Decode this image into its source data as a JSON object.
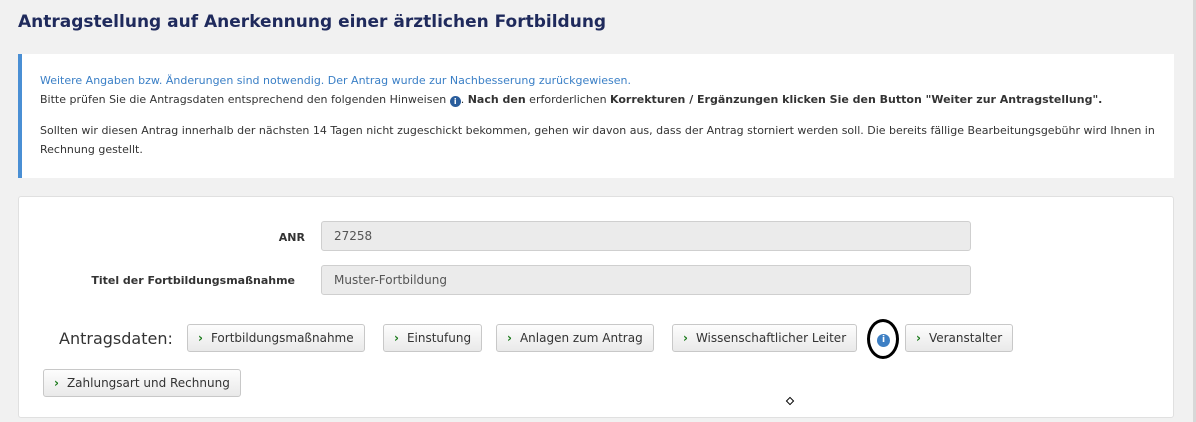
{
  "page": {
    "title": "Antragstellung auf Anerkennung einer ärztlichen Fortbildung"
  },
  "notice": {
    "line1": "Weitere Angaben bzw. Änderungen sind notwendig. Der Antrag wurde zur Nachbesserung zurückgewiesen.",
    "line2_pre": "Bitte prüfen Sie die Antragsdaten entsprechend den folgenden Hinweisen ",
    "line2_mid1": ". ",
    "line2_bold1": "Nach den",
    "line2_mid2": " erforderlichen ",
    "line2_bold2": "Korrekturen / Ergänzungen klicken Sie den Button \"Weiter zur Antragstellung\".",
    "para2": "Sollten wir diesen Antrag innerhalb der nächsten 14 Tagen nicht zugeschickt bekommen, gehen wir davon aus, dass der Antrag storniert werden soll. Die bereits fällige Bearbeitungsgebühr wird Ihnen in Rechnung gestellt.",
    "info_icon": "info-icon"
  },
  "form": {
    "anr_label": "ANR",
    "anr_value": "27258",
    "titel_label": "Titel der Fortbildungsmaßnahme",
    "titel_value": "Muster-Fortbildung"
  },
  "antragsdaten": {
    "label": "Antragsdaten:",
    "buttons": [
      "Fortbildungsmaßnahme",
      "Einstufung",
      "Anlagen zum Antrag",
      "Wissenschaftlicher Leiter",
      "Veranstalter",
      "Zahlungsart und Rechnung"
    ],
    "chevron": "›",
    "info_glyph": "i"
  },
  "colors": {
    "title": "#1f2a5c",
    "notice_border": "#4a8fd4",
    "notice_line1": "#3a7fc6",
    "chevron": "#1a7a1a",
    "info": "#3d7fc4"
  }
}
